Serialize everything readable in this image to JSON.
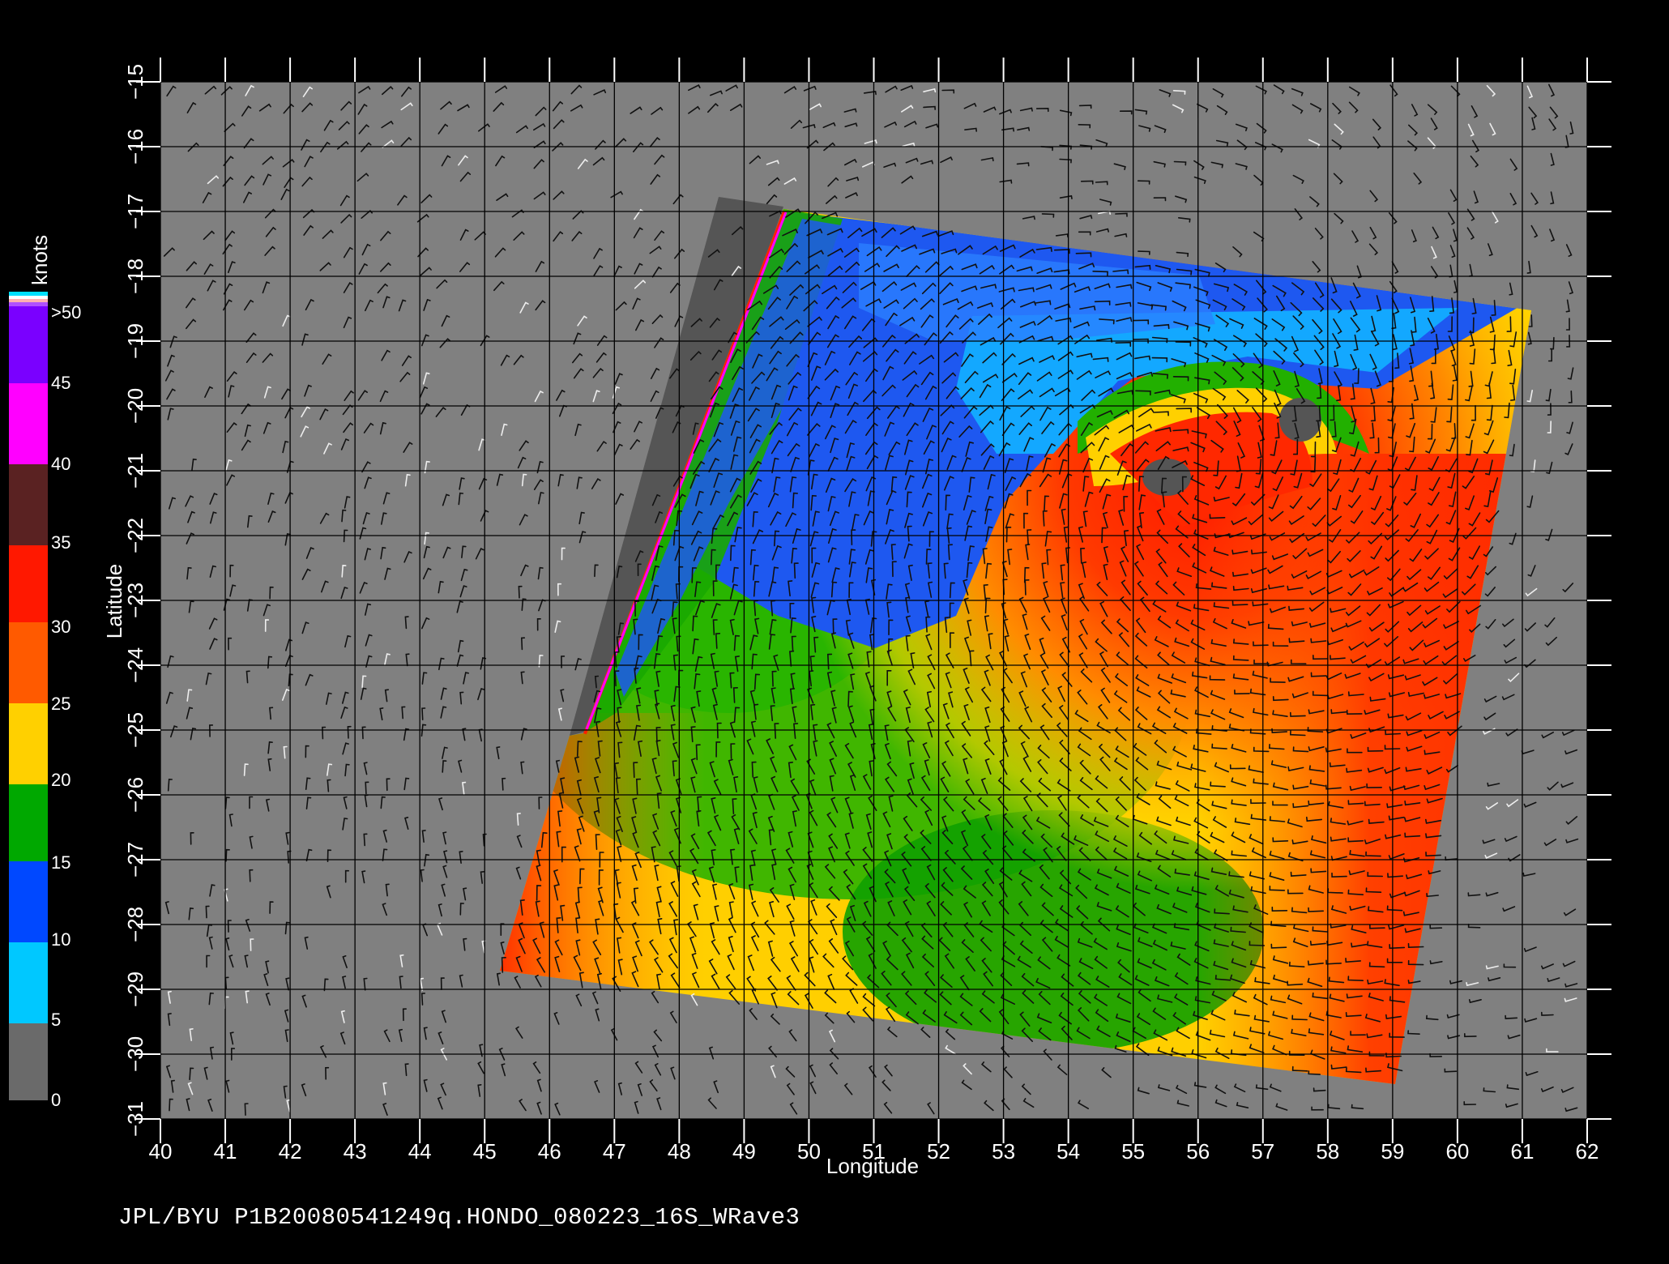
{
  "footer": "JPL/BYU  P1B20080541249q.HONDO_080223_16S_WRave3",
  "x_axis": {
    "title": "Longitude",
    "ticks": [
      "40",
      "41",
      "42",
      "43",
      "44",
      "45",
      "46",
      "47",
      "48",
      "49",
      "50",
      "51",
      "52",
      "53",
      "54",
      "55",
      "56",
      "57",
      "58",
      "59",
      "60",
      "61",
      "62"
    ],
    "range": [
      40,
      62
    ]
  },
  "y_axis": {
    "title": "Latitude",
    "ticks": [
      "-15",
      "-16",
      "-17",
      "-18",
      "-19",
      "-20",
      "-21",
      "-22",
      "-23",
      "-24",
      "-25",
      "-26",
      "-27",
      "-28",
      "-29",
      "-30",
      "-31"
    ],
    "range": [
      -31,
      -15
    ]
  },
  "colorbar": {
    "unit": "knots",
    "labels": [
      ">50",
      "45",
      "40",
      "35",
      "30",
      "25",
      "20",
      "15",
      "10",
      "5",
      "0"
    ],
    "colors": {
      "0-5": "#6f6f6f",
      "5-10": "#00e0ff",
      "10-15": "#0050ff",
      "15-20": "#00b000",
      "20-25": "#ffe000",
      "25-30": "#ff6000",
      "30-35": "#ff1000",
      "35-40": "#6a2a2a",
      "40-45": "#ff00ff",
      "45-50": "#7a00ff"
    }
  },
  "map": {
    "background_color": "#808080",
    "gridlines": true,
    "wind_vectors": true
  }
}
